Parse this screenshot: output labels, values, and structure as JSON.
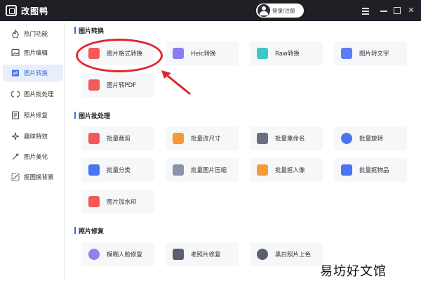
{
  "app": {
    "title": "改图鸭",
    "login_label": "登录/注册"
  },
  "sidebar": {
    "items": [
      {
        "label": "热门功能",
        "icon": "fire-icon"
      },
      {
        "label": "图片编辑",
        "icon": "image-edit-icon"
      },
      {
        "label": "图片转换",
        "icon": "image-convert-icon",
        "active": true
      },
      {
        "label": "图片批处理",
        "icon": "batch-icon"
      },
      {
        "label": "照片修复",
        "icon": "photo-repair-icon"
      },
      {
        "label": "趣味特效",
        "icon": "sparkle-icon"
      },
      {
        "label": "图片美化",
        "icon": "beautify-icon"
      },
      {
        "label": "抠图换背景",
        "icon": "cutout-icon"
      }
    ]
  },
  "sections": [
    {
      "title": "图片转换",
      "cards": [
        {
          "label": "图片格式转换",
          "icon": "format-convert-icon",
          "color": "#f25a5a"
        },
        {
          "label": "Heic转换",
          "icon": "heic-icon",
          "color": "#8b7cf6"
        },
        {
          "label": "Raw转换",
          "icon": "raw-icon",
          "color": "#3ec6c6"
        },
        {
          "label": "图片转文字",
          "icon": "image-to-text-icon",
          "color": "#5b7cf5"
        },
        {
          "label": "图片转PDF",
          "icon": "pdf-icon",
          "color": "#f25a5a"
        }
      ]
    },
    {
      "title": "图片批处理",
      "cards": [
        {
          "label": "批量裁剪",
          "icon": "crop-icon",
          "color": "#f25a5a"
        },
        {
          "label": "批量改尺寸",
          "icon": "resize-icon",
          "color": "#f59a3a"
        },
        {
          "label": "批量重命名",
          "icon": "rename-icon",
          "color": "#6b6f80"
        },
        {
          "label": "批量旋转",
          "icon": "rotate-icon",
          "color": "#4a74f0"
        },
        {
          "label": "批量分类",
          "icon": "classify-icon",
          "color": "#4a74f0"
        },
        {
          "label": "批量图片压缩",
          "icon": "compress-icon",
          "color": "#8b93a8"
        },
        {
          "label": "批量抠人像",
          "icon": "portrait-cutout-icon",
          "color": "#f59a3a"
        },
        {
          "label": "批量抠物品",
          "icon": "object-cutout-icon",
          "color": "#4a74f0"
        },
        {
          "label": "图片加水印",
          "icon": "watermark-icon",
          "color": "#f25a5a"
        }
      ]
    },
    {
      "title": "照片修复",
      "cards": [
        {
          "label": "模糊人脸修复",
          "icon": "face-repair-icon",
          "color": "#9a7cf2"
        },
        {
          "label": "老照片修复",
          "icon": "old-photo-icon",
          "color": "#5a5e6e"
        },
        {
          "label": "黑白照片上色",
          "icon": "colorize-icon",
          "color": "#5a5e6e"
        }
      ]
    }
  ],
  "watermark": "易坊好文馆",
  "accent_color": "#3b6ee0",
  "highlight_color": "#e0262b"
}
